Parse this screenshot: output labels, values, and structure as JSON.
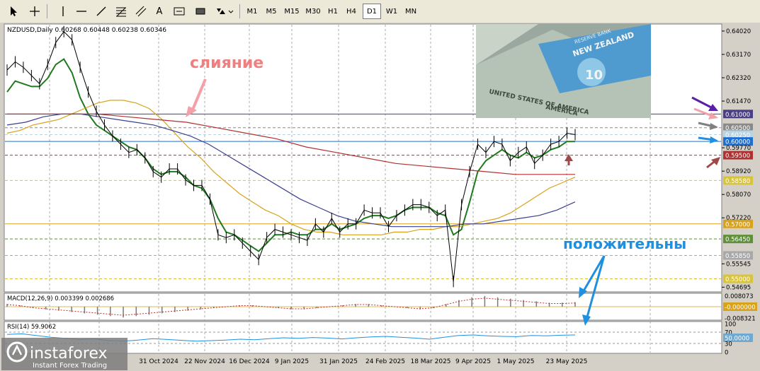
{
  "toolbar": {
    "tools": [
      "cursor-icon",
      "crosshair-icon",
      "vertical-line-icon",
      "horizontal-line-icon",
      "trend-line-icon",
      "fibonacci-icon",
      "text-icon",
      "label-icon",
      "rectangle-icon",
      "arrows-icon"
    ],
    "text_tool_label": "A",
    "timeframes": [
      "M1",
      "M5",
      "M15",
      "M30",
      "H1",
      "H4",
      "D1",
      "W1",
      "MN"
    ],
    "active_timeframe": "D1"
  },
  "chart_data": {
    "type": "line",
    "symbol_header": "NZDUSD,Daily  0.60268 0.60448 0.60238 0.60346",
    "price_axis_labels": [
      "0.64020",
      "0.63170",
      "0.62320",
      "0.61470",
      "0.61000",
      "0.60500",
      "0.60250",
      "0.60000",
      "0.59770",
      "0.59500",
      "0.58920",
      "0.58580",
      "0.58070",
      "0.57220",
      "0.57000",
      "0.56450",
      "0.55850",
      "0.55545",
      "0.55000",
      "0.54695"
    ],
    "price_axis_highlights": [
      {
        "label": "0.61000",
        "value": 0.61,
        "color": "#4a3f86"
      },
      {
        "label": "0.60500",
        "value": 0.605,
        "color": "#8a8a8a"
      },
      {
        "label": "0.60250",
        "value": 0.6025,
        "color": "#b9d3e0"
      },
      {
        "label": "0.60000",
        "value": 0.6,
        "color": "#1f6fd1"
      },
      {
        "label": "0.59500",
        "value": 0.595,
        "color": "#b03030"
      },
      {
        "label": "0.58580",
        "value": 0.5858,
        "color": "#d8c43a"
      },
      {
        "label": "0.57000",
        "value": 0.57,
        "color": "#d9a21b"
      },
      {
        "label": "0.56450",
        "value": 0.5645,
        "color": "#5f8f3a"
      },
      {
        "label": "0.55850",
        "value": 0.5585,
        "color": "#a8a8a8"
      },
      {
        "label": "0.55000",
        "value": 0.55,
        "color": "#d8c43a"
      }
    ],
    "x_labels": [
      "31 Oct 2024",
      "22 Nov 2024",
      "16 Dec 2024",
      "9 Jan 2025",
      "31 Jan 2025",
      "24 Feb 2025",
      "18 Mar 2025",
      "9 Apr 2025",
      "1 May 2025",
      "23 May 2025"
    ],
    "ylim": [
      0.5455,
      0.6425
    ],
    "price_path": [
      0.626,
      0.629,
      0.627,
      0.624,
      0.621,
      0.628,
      0.636,
      0.64,
      0.637,
      0.627,
      0.618,
      0.611,
      0.606,
      0.602,
      0.599,
      0.596,
      0.597,
      0.594,
      0.589,
      0.587,
      0.59,
      0.59,
      0.586,
      0.584,
      0.584,
      0.579,
      0.566,
      0.565,
      0.566,
      0.563,
      0.56,
      0.557,
      0.565,
      0.568,
      0.567,
      0.566,
      0.565,
      0.564,
      0.57,
      0.567,
      0.572,
      0.567,
      0.57,
      0.57,
      0.575,
      0.574,
      0.574,
      0.569,
      0.573,
      0.575,
      0.577,
      0.577,
      0.576,
      0.573,
      0.575,
      0.549,
      0.577,
      0.589,
      0.599,
      0.596,
      0.6,
      0.599,
      0.593,
      0.596,
      0.598,
      0.592,
      0.595,
      0.599,
      0.6,
      0.603,
      0.6025
    ],
    "series": [
      {
        "name": "MA fast",
        "color": "#1f7a1f",
        "values": [
          0.618,
          0.622,
          0.621,
          0.62,
          0.62,
          0.623,
          0.628,
          0.63,
          0.625,
          0.616,
          0.61,
          0.606,
          0.604,
          0.602,
          0.6,
          0.598,
          0.597,
          0.594,
          0.59,
          0.588,
          0.589,
          0.589,
          0.587,
          0.584,
          0.583,
          0.579,
          0.572,
          0.567,
          0.566,
          0.564,
          0.562,
          0.56,
          0.563,
          0.566,
          0.566,
          0.567,
          0.566,
          0.566,
          0.568,
          0.568,
          0.57,
          0.568,
          0.569,
          0.57,
          0.572,
          0.573,
          0.573,
          0.572,
          0.573,
          0.575,
          0.576,
          0.576,
          0.576,
          0.574,
          0.573,
          0.566,
          0.568,
          0.578,
          0.589,
          0.593,
          0.595,
          0.597,
          0.595,
          0.594,
          0.596,
          0.594,
          0.595,
          0.597,
          0.598,
          0.6,
          0.6
        ]
      },
      {
        "name": "MA 50",
        "color": "#d9a21b",
        "values": [
          0.603,
          0.604,
          0.606,
          0.607,
          0.608,
          0.61,
          0.612,
          0.614,
          0.615,
          0.615,
          0.614,
          0.612,
          0.608,
          0.603,
          0.598,
          0.594,
          0.589,
          0.585,
          0.581,
          0.578,
          0.575,
          0.573,
          0.57,
          0.568,
          0.567,
          0.567,
          0.566,
          0.566,
          0.566,
          0.566,
          0.567,
          0.567,
          0.568,
          0.568,
          0.569,
          0.569,
          0.57,
          0.571,
          0.572,
          0.574,
          0.577,
          0.58,
          0.583,
          0.585,
          0.587
        ]
      },
      {
        "name": "MA 100",
        "color": "#3b3f8f",
        "values": [
          0.606,
          0.607,
          0.609,
          0.61,
          0.61,
          0.609,
          0.608,
          0.607,
          0.606,
          0.604,
          0.602,
          0.599,
          0.595,
          0.591,
          0.587,
          0.583,
          0.579,
          0.576,
          0.573,
          0.571,
          0.57,
          0.569,
          0.569,
          0.569,
          0.569,
          0.57,
          0.57,
          0.571,
          0.572,
          0.573,
          0.575,
          0.578
        ]
      },
      {
        "name": "MA 200",
        "color": "#b03030",
        "values": [
          0.61,
          0.61,
          0.61,
          0.61,
          0.609,
          0.608,
          0.607,
          0.605,
          0.603,
          0.601,
          0.598,
          0.596,
          0.594,
          0.592,
          0.591,
          0.59,
          0.589,
          0.588,
          0.588,
          0.588
        ]
      }
    ],
    "annotations": {
      "confluence": "слияние",
      "positive": "положительны"
    },
    "macd": {
      "label": "MACD(12,26,9) 0.003399 0.002686",
      "axis_labels": [
        "0.008073",
        "-0.000000",
        "-0.008321"
      ],
      "values": [
        0.002,
        0.001,
        -0.001,
        -0.002,
        -0.003,
        -0.004,
        -0.005,
        -0.006,
        -0.007,
        -0.008,
        -0.007,
        -0.006,
        -0.005,
        -0.004,
        -0.003,
        -0.002,
        -0.001,
        0.0,
        0.001,
        0.001,
        0.0,
        -0.001,
        -0.002,
        -0.002,
        -0.001,
        0.0,
        0.001,
        0.002,
        0.002,
        0.001,
        0.0,
        -0.001,
        -0.002,
        -0.001,
        0.002,
        0.005,
        0.007,
        0.008,
        0.007,
        0.006,
        0.005,
        0.004,
        0.003,
        0.003,
        0.0034
      ],
      "ylim": [
        -0.0095,
        0.0095
      ]
    },
    "rsi": {
      "label": "RSI(14) 59.9062",
      "axis_labels": [
        "100",
        "70",
        "50.0000",
        "30",
        "0"
      ],
      "values": [
        62,
        64,
        58,
        52,
        48,
        44,
        46,
        40,
        38,
        42,
        47,
        44,
        41,
        38,
        40,
        42,
        45,
        43,
        47,
        50,
        48,
        51,
        49,
        46,
        50,
        53,
        55,
        52,
        49,
        45,
        52,
        58,
        60,
        57,
        55,
        54,
        58,
        57,
        59,
        60
      ],
      "ylim": [
        0,
        100
      ]
    }
  },
  "watermark": {
    "brand": "instaforex",
    "tagline": "Instant Forex Trading"
  },
  "photo_inset": {
    "description_text": [
      "NEW ZEALAND",
      "RESERVE BANK",
      "UNITED STATES OF AMERICA",
      "AMERICA",
      "10"
    ]
  }
}
